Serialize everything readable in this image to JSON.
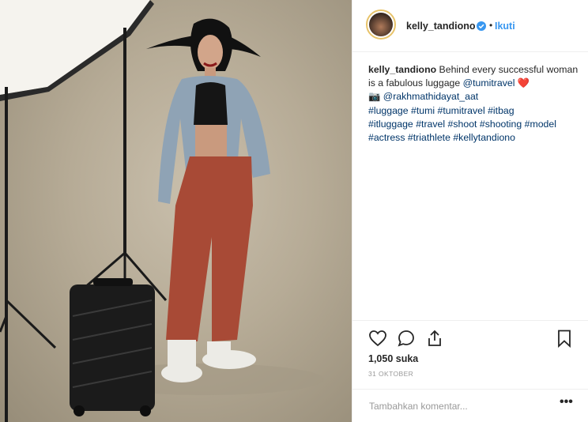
{
  "post": {
    "username": "kelly_tandiono",
    "follow_label": "Ikuti",
    "separator": "•",
    "verified": true,
    "accent_color": "#3897f0"
  },
  "caption": {
    "username": "kelly_tandiono",
    "text_1": "Behind every successful woman is a fabulous luggage",
    "mention_1": "@tumitravel",
    "heart_emoji": "❤️",
    "camera_emoji": "📷",
    "mention_2": "@rakhmathidayat_aat",
    "hashtags": [
      "#luggage",
      "#tumi",
      "#tumitravel",
      "#itbag",
      "#itluggage",
      "#travel",
      "#shoot",
      "#shooting",
      "#model",
      "#actress",
      "#triathlete",
      "#kellytandiono"
    ]
  },
  "actions": {
    "like_icon": "heart-outline-icon",
    "comment_icon": "speech-bubble-icon",
    "share_icon": "share-upload-icon",
    "save_icon": "bookmark-icon"
  },
  "likes": "1,050 suka",
  "date": "31 OKTOBER",
  "comment": {
    "placeholder": "Tambahkan komentar...",
    "more_label": "•••"
  }
}
